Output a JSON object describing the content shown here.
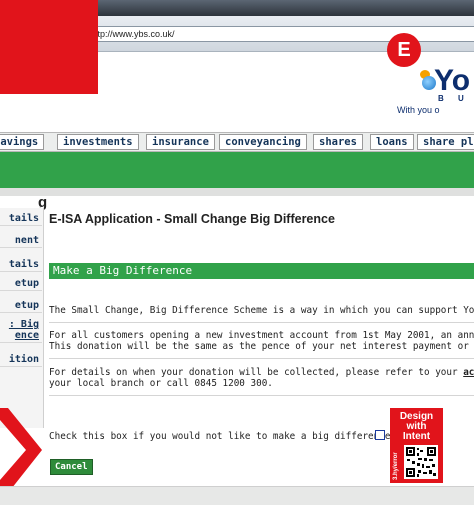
{
  "browser": {
    "url": "http://www.ybs.co.uk/"
  },
  "overlay": {
    "e_letter": "E",
    "brand_red": "#e1141b"
  },
  "logo": {
    "brand_text": "Yo",
    "sub_text": "B U",
    "tagline": "With you o"
  },
  "nav": {
    "tabs": [
      "savings",
      "investments",
      "insurance",
      "conveyancing",
      "shares",
      "loans",
      "share pl"
    ],
    "accent": "#31a24a"
  },
  "sidebar": {
    "cut_heading": "g",
    "items": [
      "tails",
      "nent",
      "tails",
      "etup",
      "etup",
      ": Big",
      "ence",
      "ition"
    ]
  },
  "main": {
    "title": "E-ISA Application - Small Change Big Difference",
    "section_header": "Make a Big Difference",
    "para1": "The Small Change, Big Difference Scheme is a way in which you can support Yor",
    "para2_line1": "For all customers opening a new investment account from 1st May 2001, an annu",
    "para2_line2": "This donation will be the same as the pence of your net interest payment or gros",
    "para3_line1_pre": "For details on when your donation will be collected, please refer to your ",
    "para3_line1_link": "account",
    "para3_line2": "your local branch or call 0845 1200 300.",
    "checkbox_label": "Check this box if you would not like to make a big difference",
    "cancel_label": "Cancel"
  },
  "badge": {
    "line1": "Design",
    "line2": "with",
    "line3": "Intent",
    "vertical": "3.hy/error"
  }
}
